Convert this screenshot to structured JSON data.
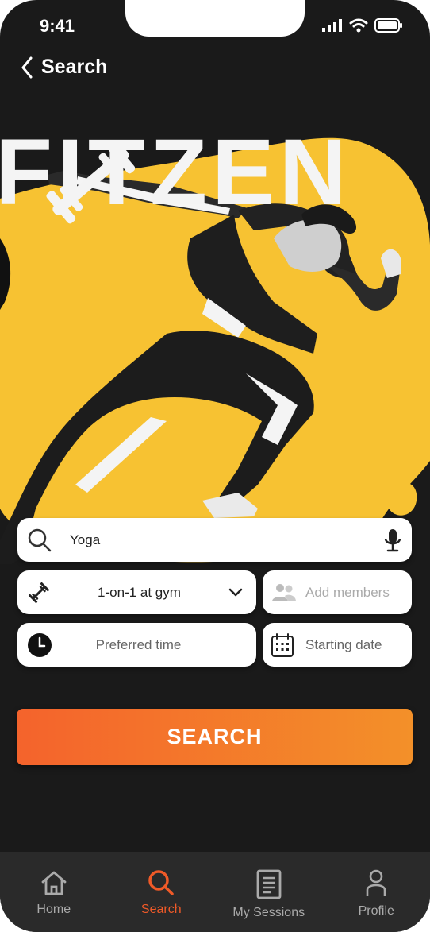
{
  "status_bar": {
    "time": "9:41"
  },
  "header": {
    "back_label": "Search"
  },
  "hero": {
    "brand": "FITZEN"
  },
  "search_form": {
    "query_value": "Yoga",
    "session_type_value": "1-on-1 at gym",
    "members_placeholder": "Add members",
    "time_placeholder": "Preferred time",
    "date_placeholder": "Starting date",
    "submit_label": "SEARCH"
  },
  "tabbar": {
    "items": [
      {
        "label": "Home",
        "icon": "home-icon"
      },
      {
        "label": "Search",
        "icon": "search-icon"
      },
      {
        "label": "My Sessions",
        "icon": "document-icon"
      },
      {
        "label": "Profile",
        "icon": "person-icon"
      }
    ],
    "active": "Search"
  },
  "colors": {
    "accent": "#f05a28",
    "gradient_start": "#f4632c",
    "gradient_end": "#f39029",
    "brand_yellow": "#f7c232",
    "background": "#1a1a1a"
  }
}
